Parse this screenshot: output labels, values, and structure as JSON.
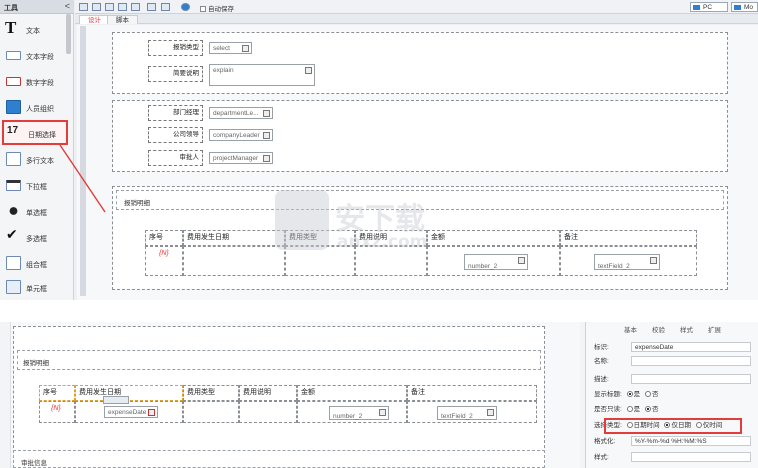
{
  "sidebar": {
    "title": "工具",
    "collapse": "<",
    "items": [
      {
        "label": "文本",
        "icon": "text-icon"
      },
      {
        "label": "文本字段",
        "icon": "textfield-icon"
      },
      {
        "label": "数字字段",
        "icon": "number-field-icon"
      },
      {
        "label": "人员组织",
        "icon": "person-icon"
      },
      {
        "label": "日期选择",
        "icon": "calendar-icon",
        "badge": "17"
      },
      {
        "label": "多行文本",
        "icon": "multiline-icon"
      },
      {
        "label": "下拉框",
        "icon": "dropdown-icon"
      },
      {
        "label": "单选框",
        "icon": "radio-icon"
      },
      {
        "label": "多选框",
        "icon": "checkbox-icon"
      },
      {
        "label": "组合框",
        "icon": "combo-icon"
      },
      {
        "label": "单元框",
        "icon": "cell-icon"
      }
    ]
  },
  "toolbar": {
    "autosave": "自动保存",
    "view_pc": "PC",
    "view_mobile": "Mo"
  },
  "tabs": [
    "设计",
    "脚本"
  ],
  "form": {
    "reimburse_type_label": "报销类型",
    "reimburse_type_value": "select",
    "brief_label": "简要说明",
    "brief_value": "explain",
    "dept_manager_label": "部门经理",
    "dept_manager_value": "departmentLe...",
    "company_leader_label": "公司领导",
    "company_leader_value": "companyLeader",
    "approver_label": "审批人",
    "approver_value": "projectManager",
    "detail_section": "报销明细",
    "table_headers": [
      "序号",
      "费用发生日期",
      "费用类型",
      "费用说明",
      "金额",
      "备注"
    ],
    "row_index": "{N}",
    "amount_field": "number_2",
    "note_field": "textField_2"
  },
  "bottom": {
    "detail_section": "报销明细",
    "table_headers": [
      "序号",
      "费用发生日期",
      "费用类型",
      "费用说明",
      "金额",
      "备注"
    ],
    "row_index": "{N}",
    "date_field": "expenseDate",
    "amount_field": "number_2",
    "note_field": "textField_2",
    "next_section": "审批信息",
    "prop_tabs": [
      "基本",
      "校验",
      "样式",
      "扩展"
    ],
    "props": {
      "label_key": "标识:",
      "label_val": "expenseDate",
      "name_key": "名称:",
      "desc_key": "描述:",
      "show_title_key": "显示标题:",
      "show_title_yes": "是",
      "show_title_no": "否",
      "readonly_key": "是否只读:",
      "readonly_yes": "是",
      "readonly_no": "否",
      "select_type_key": "选择类型:",
      "opt_datetime": "日期时间",
      "opt_date": "仅日期",
      "opt_time": "仅时间",
      "format_key": "格式化:",
      "format_val": "%Y-%m-%d %H:%M:%S",
      "style_key": "样式:"
    }
  },
  "watermark": {
    "text": "安下载",
    "sub": "anxz.com"
  },
  "colors": {
    "highlight": "#e23c3c",
    "accent": "#2f7fd1"
  }
}
